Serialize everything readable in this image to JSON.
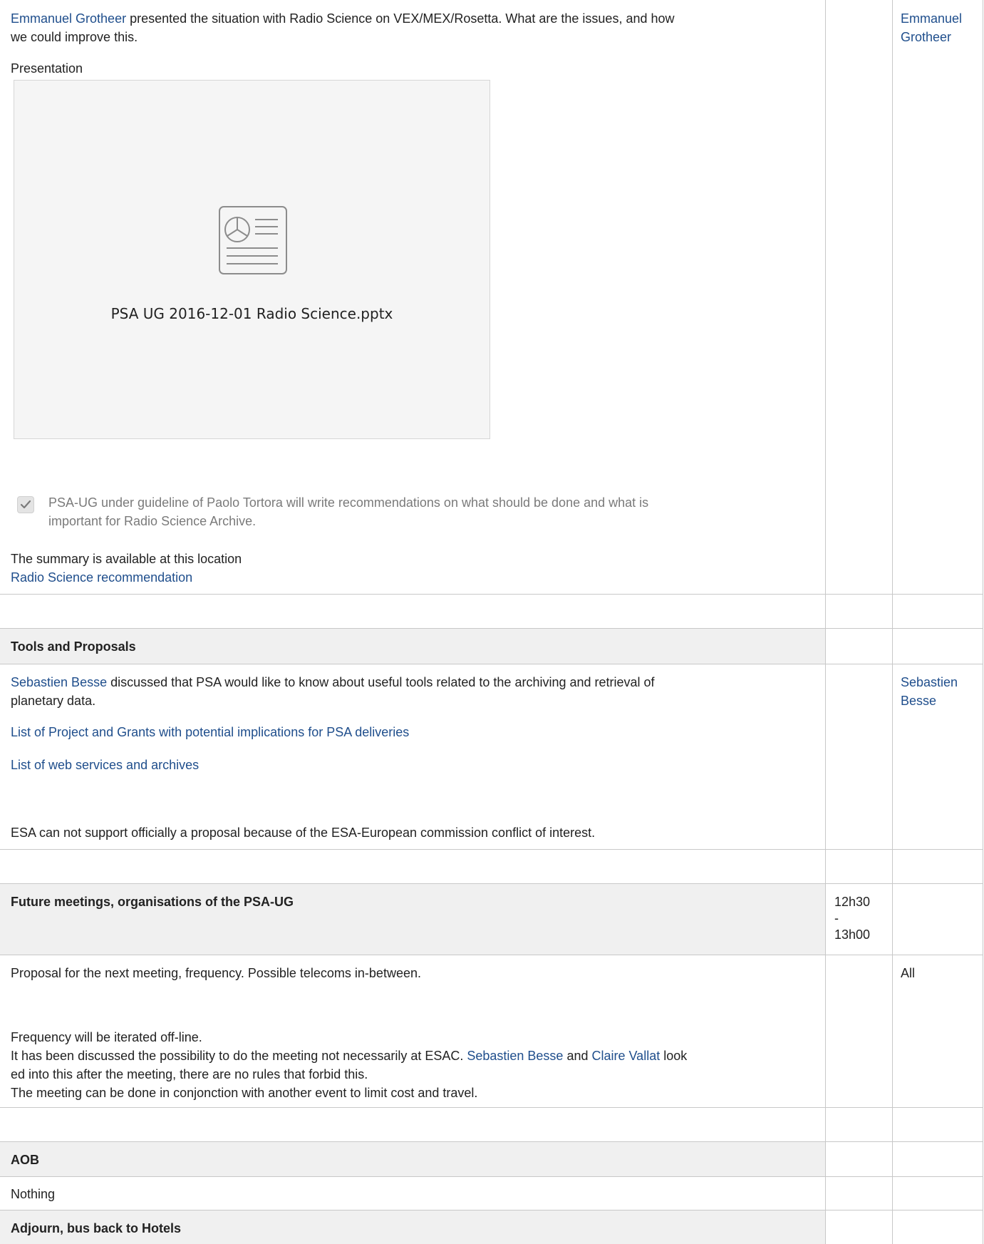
{
  "section1": {
    "presenter_link": "Emmanuel Grotheer",
    "description_rest": " presented the situation with Radio Science on VEX/MEX/Rosetta. What are the issues, and how",
    "description_line2": "we could improve this.",
    "presentation_label": "Presentation",
    "attachment_filename": "PSA UG 2016-12-01 Radio Science.pptx",
    "task_line1": "PSA-UG under guideline of Paolo Tortora will write recommendations on what should be done and what is",
    "task_line2": "important for Radio Science Archive.",
    "task_checked": true,
    "summary_text": "The summary is available at this location",
    "summary_link": "Radio Science recommendation",
    "who_line1": "Emmanuel",
    "who_line2": "Grotheer"
  },
  "tools": {
    "heading": "Tools and Proposals",
    "presenter_link": "Sebastien Besse",
    "description_rest": " discussed that PSA would like to know about useful tools related to the archiving and retrieval of",
    "description_line2": "planetary data.",
    "link1": "List of Project and Grants with potential implications for PSA deliveries",
    "link2": "List of web services and archives",
    "note": "ESA can not support officially a proposal because of the ESA-European commission conflict of interest.",
    "who_line1": "Sebastien",
    "who_line2": "Besse"
  },
  "future": {
    "heading": "Future meetings, organisations of the PSA-UG",
    "time_line1": "12h30",
    "time_line2": "-",
    "time_line3": "13h00",
    "proposal": "Proposal for the next meeting, frequency. Possible telecoms in-between.",
    "who": "All",
    "frequency": "Frequency will be iterated off-line.",
    "discussed_pre": "It has been discussed the possibility to do the meeting not necessarily at ESAC. ",
    "link_a": "Sebastien Besse",
    "and": " and ",
    "link_b": "Claire Vallat",
    "discussed_post": " look",
    "discussed_line2": "ed into this after the meeting, there are no rules that forbid this.",
    "conjunction": "The meeting can be done in conjonction with another event to limit cost and travel."
  },
  "aob": {
    "heading": "AOB",
    "content": "Nothing"
  },
  "adjourn": {
    "heading": "Adjourn, bus back to Hotels"
  }
}
